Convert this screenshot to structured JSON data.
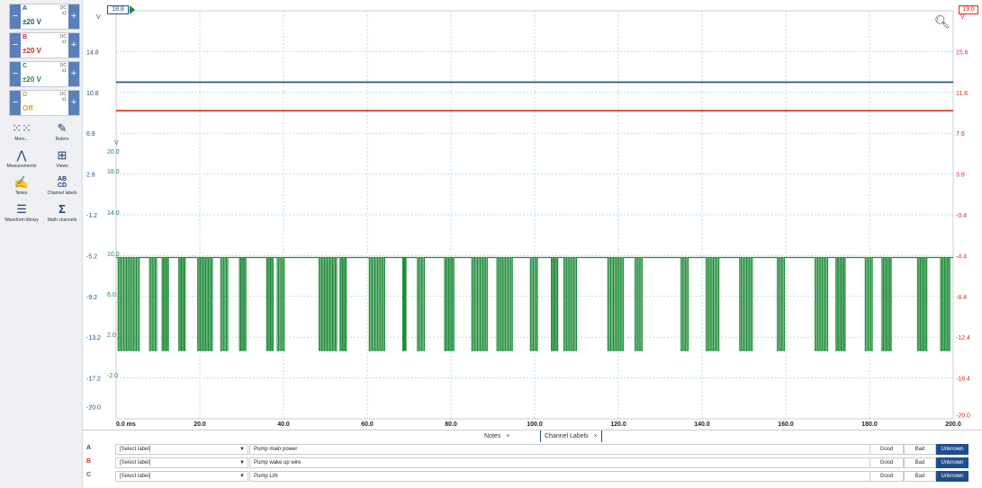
{
  "channels": [
    {
      "letter": "A",
      "coupling": "DC",
      "probe": "x1",
      "range": "±20 V",
      "color": "#1f4e8c"
    },
    {
      "letter": "B",
      "coupling": "DC",
      "probe": "x1",
      "range": "±20 V",
      "color": "#d62c20"
    },
    {
      "letter": "C",
      "coupling": "DC",
      "probe": "x1",
      "range": "±20 V",
      "color": "#1f8c3a"
    },
    {
      "letter": "D",
      "coupling": "DC",
      "probe": "x1",
      "range": "Off",
      "color": "#e89a1c"
    }
  ],
  "tools": [
    {
      "label": "More...",
      "icon": "grid-dots-icon"
    },
    {
      "label": "Rulers",
      "icon": "ruler-icon"
    },
    {
      "label": "Measurements",
      "icon": "compass-icon"
    },
    {
      "label": "Views",
      "icon": "views-grid-icon"
    },
    {
      "label": "Notes",
      "icon": "notes-icon"
    },
    {
      "label": "Channel labels",
      "icon": "channel-labels-icon"
    },
    {
      "label": "Waveform library",
      "icon": "waveform-library-icon"
    },
    {
      "label": "Math channels",
      "icon": "sigma-icon"
    }
  ],
  "plot": {
    "left_axis_top": "18.8",
    "left_axis_unit": "V",
    "left_ticks": [
      "14.8",
      "10.8",
      "6.8",
      "2.8",
      "-1.2",
      "-5.2",
      "-9.2",
      "-13.2",
      "-17.2",
      "-20.0"
    ],
    "green_axis_unit": "V",
    "green_ticks": [
      "20.0",
      "18.0",
      "14.0",
      "10.0",
      "6.0",
      "2.0",
      "-2.0"
    ],
    "right_axis_top": "19.6",
    "right_axis_unit": "V",
    "right_ticks": [
      "15.6",
      "11.6",
      "7.6",
      "3.6",
      "-0.4",
      "-4.4",
      "-8.4",
      "-12.4",
      "-16.4",
      "-20.0"
    ],
    "x_ticks": [
      "0.0 ms",
      "20.0",
      "40.0",
      "60.0",
      "80.0",
      "100.0",
      "120.0",
      "140.0",
      "160.0",
      "180.0",
      "200.0"
    ],
    "series": [
      {
        "name": "A",
        "color": "#1f4e8c",
        "level": 11.8
      },
      {
        "name": "B",
        "color": "#d62c20",
        "level": 9.8
      },
      {
        "name": "C",
        "color": "#1f8c3a",
        "high": 9.6,
        "low": 0.4
      }
    ]
  },
  "tabs": [
    {
      "label": "Notes",
      "close": "×"
    },
    {
      "label": "Channel Labels",
      "close": "×"
    }
  ],
  "label_rows": [
    {
      "letter": "A",
      "color": "#1f4e8c",
      "select": "[Select label]",
      "text": "Pump main power",
      "good": "Good",
      "bad": "Bad",
      "unknown": "Unknown"
    },
    {
      "letter": "B",
      "color": "#d62c20",
      "select": "[Select label]",
      "text": "Pump wake up wire",
      "good": "Good",
      "bad": "Bad",
      "unknown": "Unknown"
    },
    {
      "letter": "C",
      "color": "#1f8c3a",
      "select": "[Select label]",
      "text": "Pump LIN",
      "good": "Good",
      "bad": "Bad",
      "unknown": "Unknown"
    }
  ]
}
